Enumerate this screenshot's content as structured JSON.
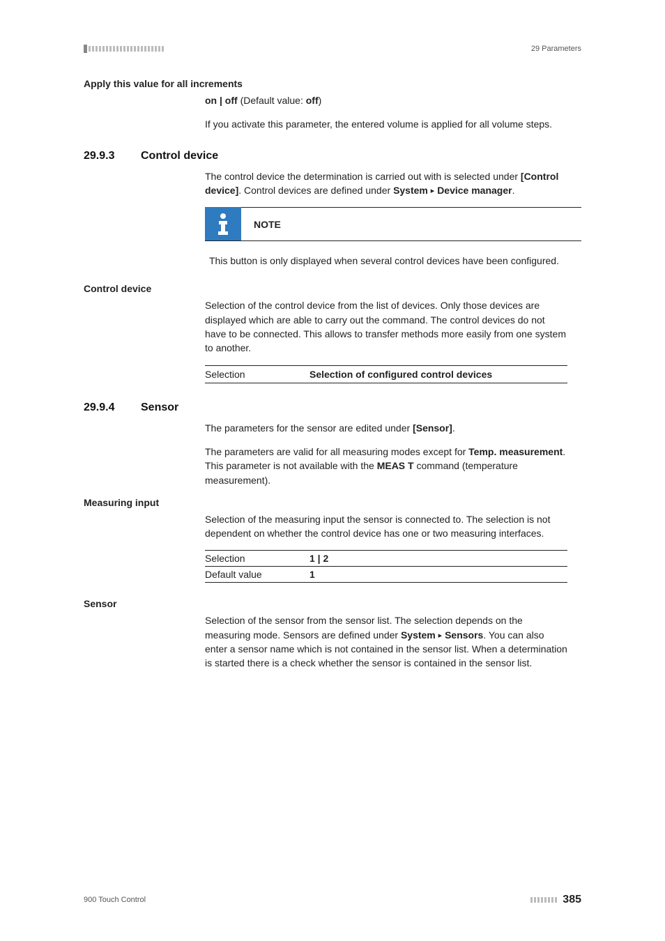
{
  "header": {
    "section_label": "29 Parameters"
  },
  "apply_increments": {
    "title": "Apply this value for all increments",
    "value_text_html": "<b>on | off</b> (Default value: <b>off</b>)",
    "desc": "If you activate this parameter, the entered volume is applied for all volume steps."
  },
  "control_device": {
    "num": "29.9.3",
    "title": "Control device",
    "intro_html": "The control device the determination is carried out with is selected under <b>[Control device]</b>. Control devices are defined under <b>System</b> <span class='tri'>▸</span> <b>Device manager</b>.",
    "note_label": "NOTE",
    "note_body": "This button is only displayed when several control devices have been configured.",
    "sub_title": "Control device",
    "sub_desc": "Selection of the control device from the list of devices. Only those devices are displayed which are able to carry out the command. The control devices do not have to be connected. This allows to transfer methods more easily from one system to another.",
    "row_key": "Selection",
    "row_val": "Selection of configured control devices"
  },
  "sensor": {
    "num": "29.9.4",
    "title": "Sensor",
    "intro1_html": "The parameters for the sensor are edited under <b>[Sensor]</b>.",
    "intro2_html": "The parameters are valid for all measuring modes except for <b>Temp. measurement</b>. This parameter is not available with the <b>MEAS T</b> command (temperature measurement).",
    "measuring": {
      "title": "Measuring input",
      "desc": "Selection of the measuring input the sensor is connected to. The selection is not dependent on whether the control device has one or two measuring interfaces.",
      "rows": [
        {
          "key": "Selection",
          "val": "1 | 2"
        },
        {
          "key": "Default value",
          "val": "1"
        }
      ]
    },
    "sensor_block": {
      "title": "Sensor",
      "desc_html": "Selection of the sensor from the sensor list. The selection depends on the measuring mode. Sensors are defined under <b>System</b> <span class='tri'>▸</span> <b>Sensors</b>. You can also enter a sensor name which is not contained in the sensor list. When a determination is started there is a check whether the sensor is contained in the sensor list."
    }
  },
  "footer": {
    "product": "900 Touch Control",
    "page": "385"
  }
}
